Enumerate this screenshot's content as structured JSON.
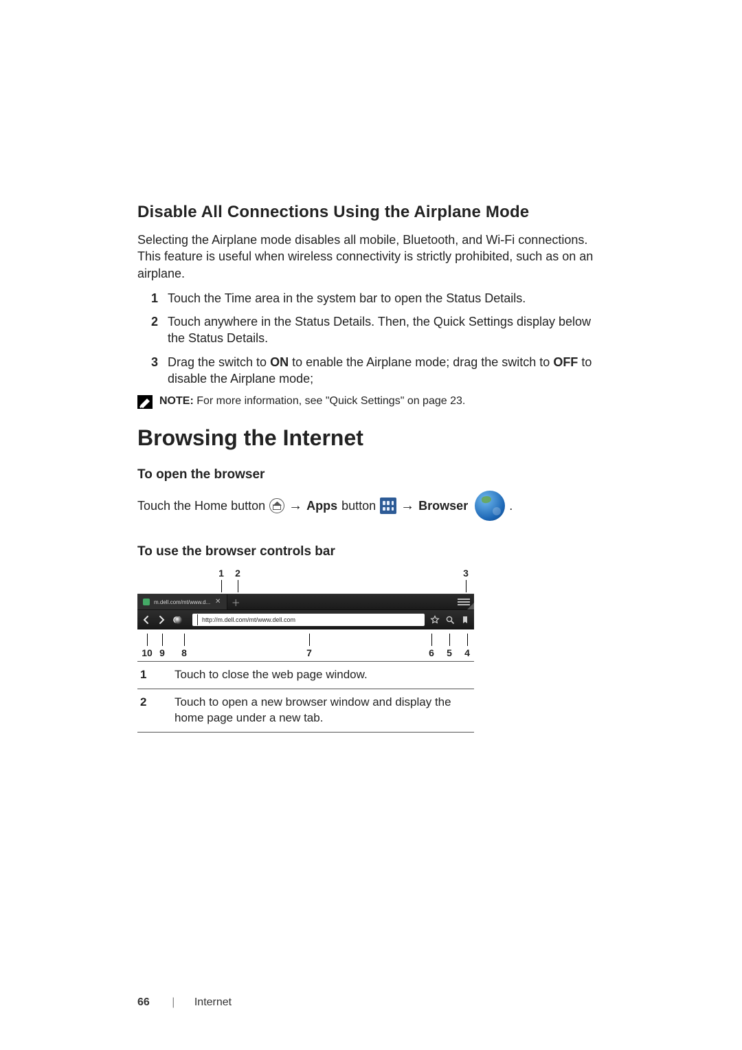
{
  "section1": {
    "title": "Disable All Connections Using the Airplane Mode",
    "intro": "Selecting the Airplane mode disables all mobile, Bluetooth, and Wi-Fi connections. This feature is useful when wireless connectivity is strictly prohibited, such as on an airplane.",
    "steps": {
      "s1": "Touch the Time area in the system bar to open the Status Details.",
      "s2": "Touch anywhere in the Status Details. Then, the Quick Settings display below the Status Details.",
      "s3_a": "Drag the switch to ",
      "s3_on": "ON",
      "s3_b": " to enable the Airplane mode; drag the switch to ",
      "s3_off": "OFF",
      "s3_c": " to disable the Airplane mode;"
    },
    "note_label": "NOTE:",
    "note_text": " For more information, see \"Quick Settings\" on page 23."
  },
  "section2": {
    "title": "Browsing the Internet",
    "sub1": "To open the browser",
    "open_a": "Touch the Home button ",
    "open_arrow": "→",
    "open_apps_label": "Apps",
    "open_button_word": " button ",
    "open_browser_label": "Browser",
    "open_period": " .",
    "sub2": "To use the browser controls bar"
  },
  "browser": {
    "tab_label": "m.dell.com/mt/www.d...",
    "url": "http://m.dell.com/mt/www.dell.com"
  },
  "callouts": {
    "c1": "1",
    "c2": "2",
    "c3": "3",
    "c4": "4",
    "c5": "5",
    "c6": "6",
    "c7": "7",
    "c8": "8",
    "c9": "9",
    "c10": "10"
  },
  "desc": {
    "n1": "1",
    "t1": "Touch to close the web page window.",
    "n2": "2",
    "t2": "Touch to open a new browser window and display the home page under a new tab."
  },
  "footer": {
    "page": "66",
    "sep": "|",
    "section": "Internet"
  }
}
